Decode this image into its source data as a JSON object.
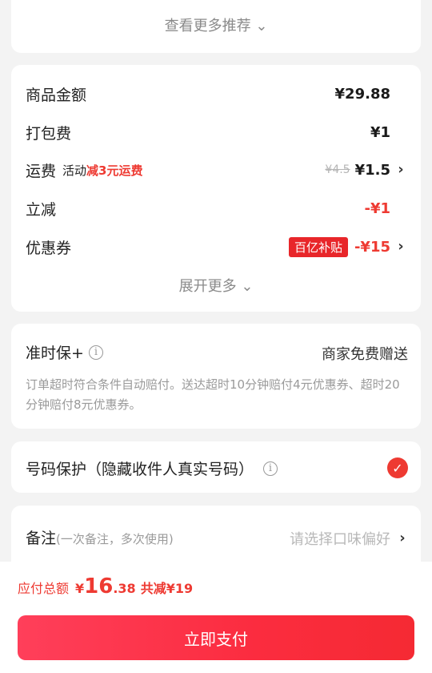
{
  "more_recommend": "查看更多推荐",
  "more_recommend_chev": "⌄",
  "costs": {
    "goods_label": "商品金额",
    "goods_amount": "¥29.88",
    "pack_label": "打包费",
    "pack_amount": "¥1",
    "ship_label": "运费",
    "ship_activity_prefix": "活动",
    "ship_activity_hl": "减3元运费",
    "ship_original": "¥4.5",
    "ship_amount": "¥1.5",
    "instant_label": "立减",
    "instant_amount": "-¥1",
    "coupon_label": "优惠券",
    "coupon_badge": "百亿补贴",
    "coupon_amount": "-¥15",
    "expand_more": "展开更多",
    "chevron": "›"
  },
  "ontime": {
    "title": "准时保+",
    "info": "i",
    "right": "商家免费赠送",
    "desc": "订单超时符合条件自动赔付。送达超时10分钟赔付4元优惠券、超时20分钟赔付8元优惠券。"
  },
  "phone": {
    "label": "号码保护（隐藏收件人真实号码）",
    "info": "i",
    "check": "✓",
    "checked": true
  },
  "notes": {
    "label": "备注",
    "sub": "(一次备注，多次使用)",
    "placeholder": "请选择口味偏好",
    "chevron": "›"
  },
  "bottom": {
    "total_label": "应付总额",
    "yen": "¥",
    "total_int": "16",
    "total_dec": ".38",
    "saved": "共减¥19",
    "pay_button": "立即支付"
  },
  "colors": {
    "accent": "#ee3a32",
    "badge": "#e8262a",
    "muted": "#9a9a9a"
  }
}
